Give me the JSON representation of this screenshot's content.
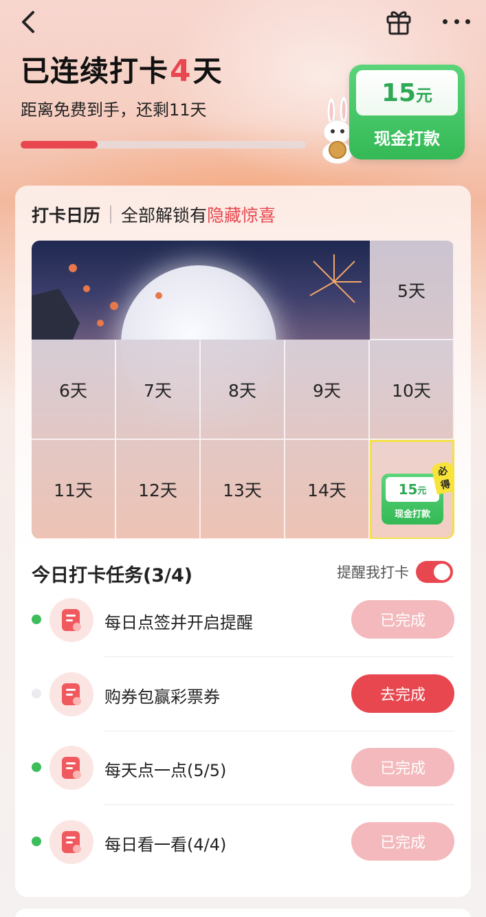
{
  "header": {
    "title_prefix": "已连续打卡",
    "title_days": "4",
    "title_suffix": "天",
    "subtitle": "距离免费到手，还剩11天",
    "progress_fraction": 0.27,
    "icons": [
      "back-arrow-icon",
      "gift-icon",
      "more-icon"
    ]
  },
  "reward": {
    "amount": "15",
    "unit": "元",
    "label": "现金打款"
  },
  "calendar": {
    "title": "打卡日历",
    "subtitle_prefix": "全部解锁有",
    "subtitle_highlight": "隐藏惊喜",
    "days": [
      "5天",
      "6天",
      "7天",
      "8天",
      "9天",
      "10天",
      "11天",
      "12天",
      "13天",
      "14天"
    ],
    "final_reward": {
      "amount": "15",
      "unit": "元",
      "label": "现金打款",
      "badge": "必得"
    }
  },
  "tasks": {
    "title": "今日打卡任务(3/4)",
    "remind_label": "提醒我打卡",
    "remind_on": true,
    "items": [
      {
        "name": "每日点签并开启提醒",
        "button": "已完成",
        "done": true
      },
      {
        "name": "购券包赢彩票券",
        "button": "去完成",
        "done": false
      },
      {
        "name": "每天点一点(5/5)",
        "button": "已完成",
        "done": true
      },
      {
        "name": "每日看一看(4/4)",
        "button": "已完成",
        "done": true
      }
    ]
  },
  "colors": {
    "accent": "#e8474f",
    "reward_green": "#34b956",
    "done_button": "#f4b9bd",
    "done_dot": "#3dbd5c"
  }
}
